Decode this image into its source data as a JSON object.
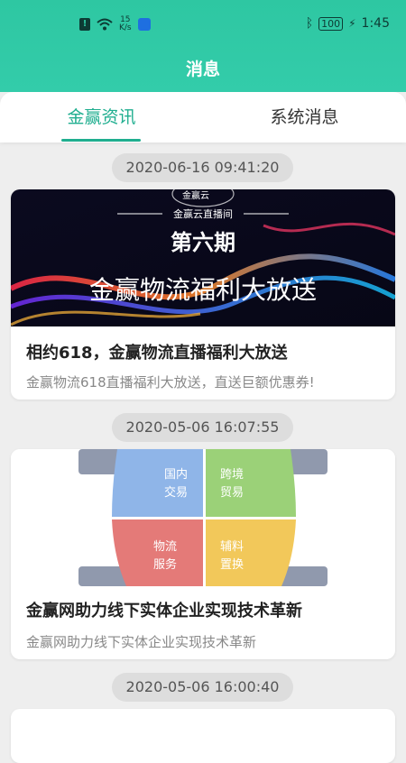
{
  "status": {
    "speed_top": "15",
    "speed_unit": "K/s",
    "battery": "100",
    "time": "1:45"
  },
  "header": {
    "title": "消息"
  },
  "tabs": [
    {
      "label": "金赢资讯",
      "active": true
    },
    {
      "label": "系统消息",
      "active": false
    }
  ],
  "colors": {
    "accent": "#1fae8f",
    "header": "#2ec7a2"
  },
  "feed": [
    {
      "timestamp": "2020-06-16 09:41:20",
      "banner": {
        "brand": "金赢云",
        "subtitle": "金赢云直播间",
        "period": "第六期",
        "slogan": "金赢物流福利大放送"
      },
      "title": "相约618，金赢物流直播福利大放送",
      "desc": "金赢物流618直播福利大放送，直送巨额优惠券!"
    },
    {
      "timestamp": "2020-05-06 16:07:55",
      "quadrants": [
        "国内交易",
        "跨境贸易",
        "物流服务",
        "辅料置换"
      ],
      "quadrant_lines": [
        [
          "国内",
          "交易"
        ],
        [
          "跨境",
          "贸易"
        ],
        [
          "物流",
          "服务"
        ],
        [
          "辅料",
          "置换"
        ]
      ],
      "title": "金赢网助力线下实体企业实现技术革新",
      "desc": "金赢网助力线下实体企业实现技术革新"
    },
    {
      "timestamp": "2020-05-06 16:00:40"
    }
  ]
}
